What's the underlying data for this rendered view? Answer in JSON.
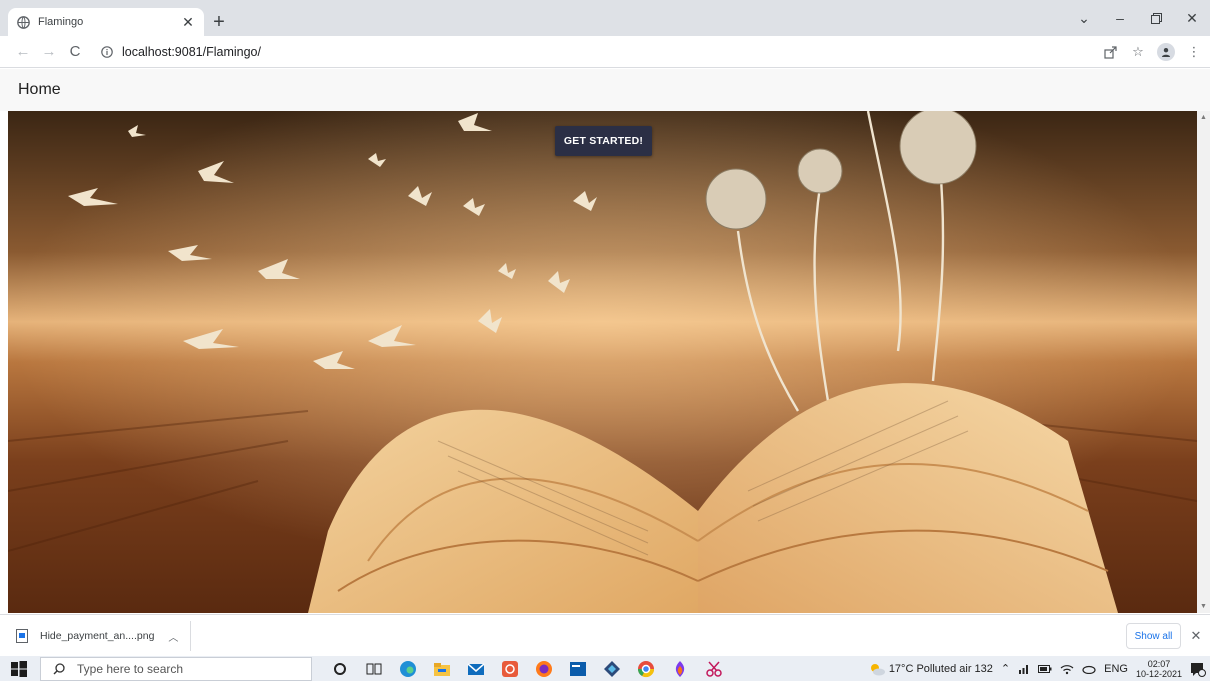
{
  "browser": {
    "tab": {
      "title": "Flamingo"
    },
    "address": {
      "url": "localhost:9081/Flamingo/"
    }
  },
  "page": {
    "header": {
      "title": "Home"
    },
    "hero": {
      "cta_label": "GET STARTED!"
    }
  },
  "downloads": {
    "file_name": "Hide_payment_an....png",
    "show_all_label": "Show all"
  },
  "taskbar": {
    "search_placeholder": "Type here to search",
    "weather": "17°C  Polluted air 132",
    "language": "ENG",
    "time": "02:07",
    "date": "10-12-2021"
  },
  "colors": {
    "cta_bg": "#2b2f45",
    "link_blue": "#1a73e8",
    "tabstrip": "#dee1e6"
  },
  "icons": {
    "tab_favicon": "globe-icon",
    "reload": "reload-icon",
    "site_info": "info-icon",
    "share": "share-icon",
    "bookmark": "star-icon",
    "profile": "avatar-icon",
    "menu": "kebab-menu-icon"
  }
}
